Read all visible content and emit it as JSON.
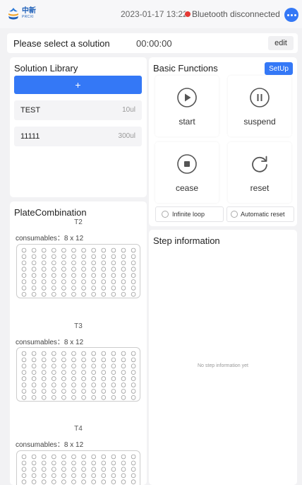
{
  "header": {
    "logo_cn": "中新",
    "logo_en": "PRCXI",
    "datetime": "2023-01-17 13:22:0",
    "bluetooth_status": "Bluetooth disconnected",
    "status_color": "#e53935"
  },
  "solution_bar": {
    "title": "Please select a solution",
    "timer": "00:00:00",
    "edit_label": "edit"
  },
  "library": {
    "title": "Solution Library",
    "add_label": "+",
    "items": [
      {
        "name": "TEST",
        "volume": "10ul"
      },
      {
        "name": "11111",
        "volume": "300ul"
      }
    ]
  },
  "functions": {
    "title": "Basic Functions",
    "setup_label": "SetUp",
    "start": "start",
    "suspend": "suspend",
    "cease": "cease",
    "reset": "reset",
    "infinite_loop": "Infinite loop",
    "automatic_reset": "Automatic reset"
  },
  "plate": {
    "title": "PlateCombination",
    "plates": [
      {
        "name": "T2",
        "consumables": "consumables：8 x 12"
      },
      {
        "name": "T3",
        "consumables": "consumables：8 x 12"
      },
      {
        "name": "T4",
        "consumables": "consumables：8 x 12"
      }
    ]
  },
  "step": {
    "title": "Step information",
    "empty_text": "No step information yet"
  },
  "colors": {
    "accent": "#3478f6",
    "background": "#f2f2f4"
  }
}
